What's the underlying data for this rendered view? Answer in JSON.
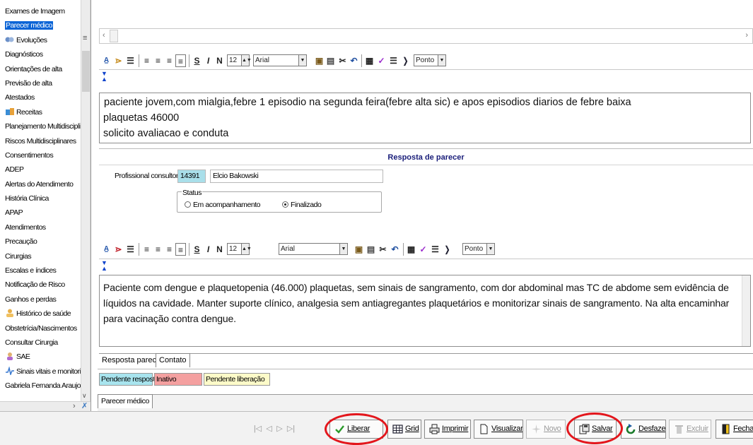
{
  "sidebar": {
    "items": [
      {
        "label": "Exames de Imagem",
        "icon": null
      },
      {
        "label": "Parecer médico",
        "icon": null,
        "selected": true
      },
      {
        "label": "Evoluções",
        "icon": "stethoscope-icon"
      },
      {
        "label": "Diagnósticos",
        "icon": null
      },
      {
        "label": "Orientações de alta",
        "icon": null
      },
      {
        "label": "Previsão de alta",
        "icon": null
      },
      {
        "label": "Atestados",
        "icon": null
      },
      {
        "label": "Receitas",
        "icon": "pharmacy-icon"
      },
      {
        "label": "Planejamento Multidisciplin",
        "icon": null
      },
      {
        "label": "Riscos Multidisciplinares",
        "icon": null
      },
      {
        "label": "Consentimentos",
        "icon": null
      },
      {
        "label": "ADEP",
        "icon": null
      },
      {
        "label": "Alertas do Atendimento",
        "icon": null
      },
      {
        "label": "História Clínica",
        "icon": null
      },
      {
        "label": "APAP",
        "icon": null
      },
      {
        "label": "Atendimentos",
        "icon": null
      },
      {
        "label": "Precaução",
        "icon": null
      },
      {
        "label": "Cirurgias",
        "icon": null
      },
      {
        "label": "Escalas e índices",
        "icon": null
      },
      {
        "label": "Notificação de Risco",
        "icon": null
      },
      {
        "label": "Ganhos e perdas",
        "icon": null
      },
      {
        "label": "Histórico de saúde",
        "icon": "person-icon"
      },
      {
        "label": "Obstetrícia/Nascimentos",
        "icon": null
      },
      {
        "label": "Consultar Cirurgia",
        "icon": null
      },
      {
        "label": "SAE",
        "icon": "nurse-icon"
      },
      {
        "label": "Sinais vitais e monitoriz",
        "icon": "vitals-icon"
      },
      {
        "label": "Gabriela Fernanda Araujo",
        "icon": null
      }
    ]
  },
  "editor_toolbar": {
    "font_size": "12",
    "font_name": "Arial",
    "unit": "Ponto",
    "bold": "S",
    "italic": "I",
    "negrito": "N"
  },
  "request_text": [
    "paciente jovem,com mialgia,febre 1 episodio na segunda feira(febre alta sic) e apos episodios diarios de febre baixa",
    "plaquetas 46000",
    "solicito avaliacao e conduta"
  ],
  "response": {
    "title": "Resposta de parecer",
    "consultant_label": "Profissional consultor:",
    "consultant_code": "14391",
    "consultant_name": "Elcio Bakowski",
    "status_label": "Status",
    "status_options": [
      "Em acompanhamento",
      "Finalizado"
    ],
    "status_selected": "Finalizado",
    "text": "Paciente com dengue e plaquetopenia (46.000) plaquetas, sem sinais de sangramento, com dor abdominal mas TC de abdome sem evidência de líquidos na cavidade. Manter suporte clínico, analgesia sem antiagregantes plaquetários e monitorizar sinais de sangramento. Na alta encaminhar para vacinação contra dengue."
  },
  "inner_tabs": [
    "Resposta parecer",
    "Contato"
  ],
  "legend": [
    {
      "label": "Pendente resposta",
      "color": "#a8e4ee"
    },
    {
      "label": "Inativo",
      "color": "#f4a0a0"
    },
    {
      "label": "Pendente liberação",
      "color": "#fdfbc9"
    }
  ],
  "main_tab": "Parecer médico",
  "actions": [
    {
      "label": "Liberar",
      "icon": "check-icon",
      "enabled": true
    },
    {
      "label": "Grid",
      "icon": "grid-icon",
      "enabled": true
    },
    {
      "label": "Imprimir",
      "icon": "printer-icon",
      "enabled": true
    },
    {
      "label": "Visualizar",
      "icon": "document-icon",
      "enabled": true
    },
    {
      "label": "Novo",
      "icon": "new-icon",
      "enabled": false
    },
    {
      "label": "Salvar",
      "icon": "save-icon",
      "enabled": true
    },
    {
      "label": "Desfazer",
      "icon": "undo-icon",
      "enabled": true
    },
    {
      "label": "Excluir",
      "icon": "delete-icon",
      "enabled": false
    },
    {
      "label": "Fechar",
      "icon": "close-icon",
      "enabled": true
    }
  ],
  "highlight_color": "#e3161c"
}
